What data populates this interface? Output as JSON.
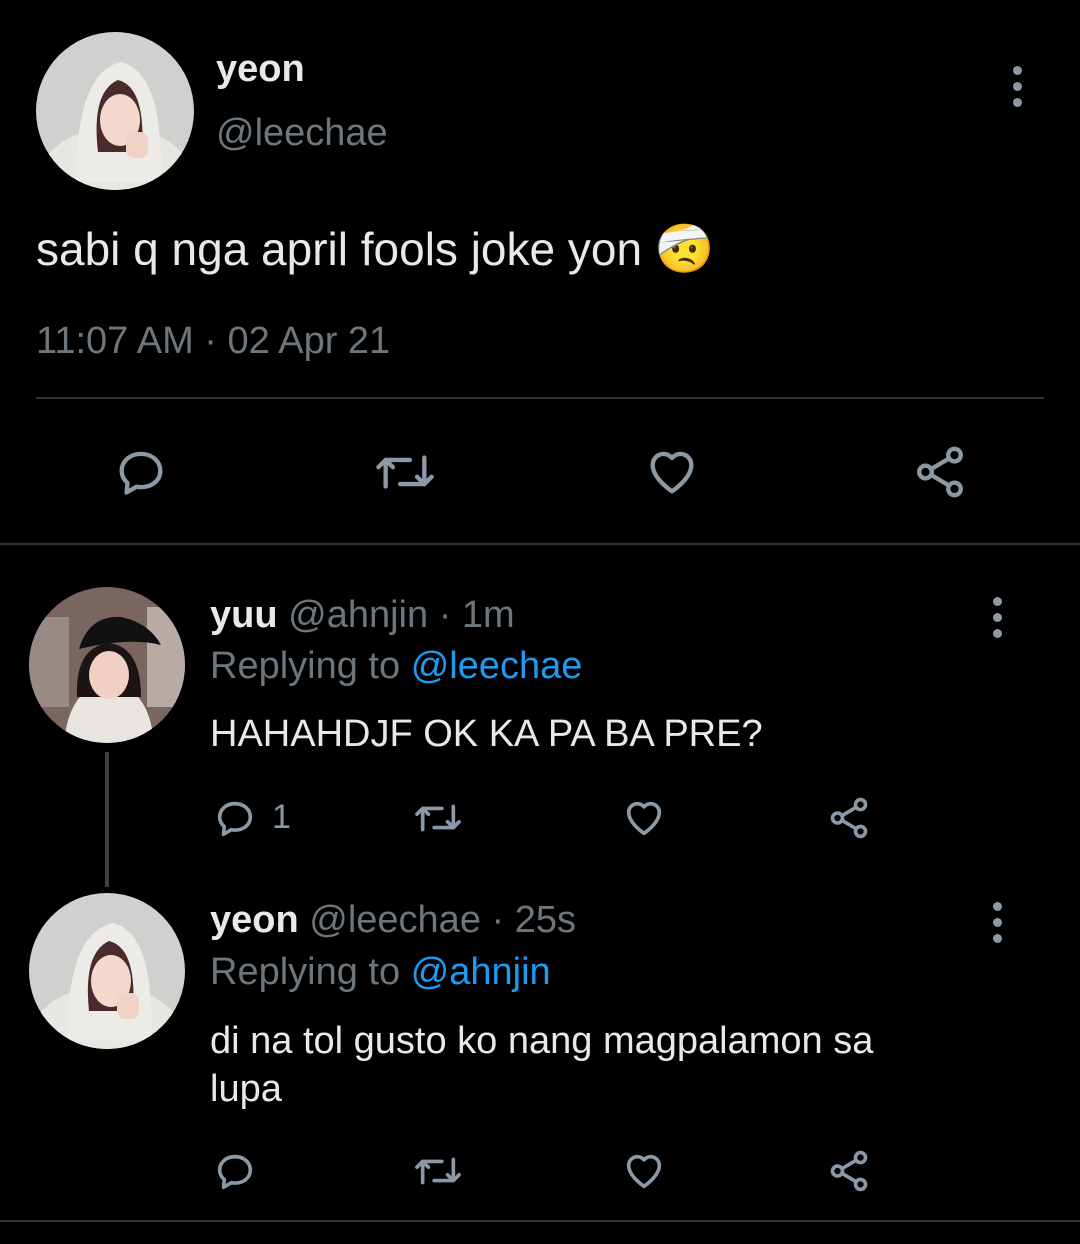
{
  "main_tweet": {
    "display_name": "yeon",
    "handle": "@leechae",
    "text": "sabi q nga april fools joke yon",
    "emoji": "🤕",
    "timestamp": "11:07 AM · 02 Apr 21"
  },
  "replies": [
    {
      "display_name": "yuu",
      "handle": "@ahnjin",
      "age": "· 1m",
      "replying_prefix": "Replying to",
      "replying_to": "@leechae",
      "text": "HAHAHDJF OK KA PA BA PRE?",
      "reply_count": "1"
    },
    {
      "display_name": "yeon",
      "handle": "@leechae",
      "age": "· 25s",
      "replying_prefix": "Replying to",
      "replying_to": "@ahnjin",
      "text_line1": "di na tol gusto ko nang magpalamon sa",
      "text_line2": "lupa"
    }
  ],
  "icons": {
    "reply": "reply-icon",
    "retweet": "retweet-icon",
    "like": "heart-icon",
    "share": "share-icon",
    "more": "more-options-icon"
  },
  "colors": {
    "background": "#000000",
    "link": "#1d9bf0",
    "muted": "#6e767d",
    "icon": "#8b98a5"
  }
}
